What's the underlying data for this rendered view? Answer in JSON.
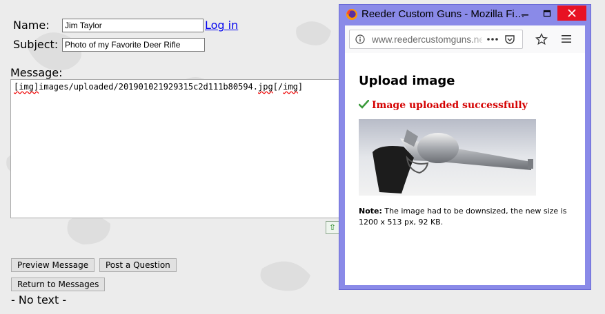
{
  "form": {
    "name_label": "Name:",
    "name_value": "Jim Taylor",
    "login_link": "Log in",
    "subject_label": "Subject:",
    "subject_value": "Photo of my Favorite Deer Rifle",
    "message_label": "Message:",
    "message_value": {
      "tag_open": "[img]",
      "path": "images/uploaded/201901021929315c2d111b80594.",
      "ext": "jpg",
      "tag_close_start": "[/",
      "tag_close_name": "img",
      "tag_close_end": "]"
    },
    "preview_button": "Preview Message",
    "post_button": "Post a Question",
    "return_button": "Return to Messages",
    "status_text": "- No text -"
  },
  "popup": {
    "window_title": "Reeder Custom Guns - Mozilla Fi…",
    "url": "www.reedercustomguns.net/fo",
    "heading": "Upload image",
    "success_message": "Image uploaded successfully",
    "note_label": "Note:",
    "note_text": " The image had to be downsized, the new size is 1200 x 513 px, 92 KB.",
    "icons": {
      "browser": "firefox-icon",
      "info": "info-icon",
      "more": "more-icon",
      "pocket": "pocket-icon",
      "bookmark": "star-icon",
      "menu": "hamburger-menu-icon",
      "success": "checkmark-icon"
    }
  },
  "colors": {
    "popup_frame": "#8a8ae8",
    "close_button": "#e81123",
    "success_red": "#d40000",
    "link_blue": "#0000ee"
  }
}
